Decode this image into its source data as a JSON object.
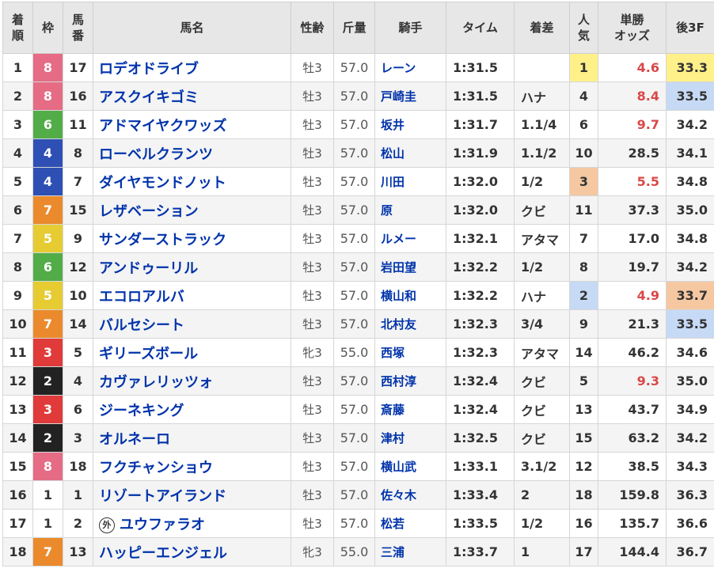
{
  "headers": {
    "rank": [
      "着",
      "順"
    ],
    "waku": "枠",
    "number": [
      "馬",
      "番"
    ],
    "name": "馬名",
    "sex_age": "性齢",
    "weight": "斤量",
    "jockey": "騎手",
    "time": "タイム",
    "margin": "着差",
    "popularity": [
      "人",
      "気"
    ],
    "odds": [
      "単勝",
      "オッズ"
    ],
    "last3f": "後3F"
  },
  "colors": {
    "waku": {
      "1": {
        "bg": "#ffffff",
        "fg": "#333333"
      },
      "2": {
        "bg": "#222222",
        "fg": "#ffffff"
      },
      "3": {
        "bg": "#e03a3a",
        "fg": "#ffffff"
      },
      "4": {
        "bg": "#2e50b4",
        "fg": "#ffffff"
      },
      "5": {
        "bg": "#e6cc32",
        "fg": "#ffffff"
      },
      "6": {
        "bg": "#52ac48",
        "fg": "#ffffff"
      },
      "7": {
        "bg": "#ea8a2c",
        "fg": "#ffffff"
      },
      "8": {
        "bg": "#e56c84",
        "fg": "#ffffff"
      }
    },
    "pop_highlight": {
      "1": "#fff08a",
      "2": "#c7daf5",
      "3": "#f5c8a2"
    },
    "last3f_highlight": {
      "1": "#fff08a",
      "2": "#c7daf5",
      "3": "#f5c8a2"
    },
    "odds_red": "#d94848"
  },
  "rows": [
    {
      "rank": "1",
      "waku": "8",
      "number": "17",
      "mark": "",
      "name": "ロデオドライブ",
      "sex_age": "牡3",
      "weight": "57.0",
      "jockey": "レーン",
      "time": "1:31.5",
      "margin": "",
      "popularity": "1",
      "odds": "4.6",
      "last3f": "33.3",
      "pop_rank": "1",
      "last3f_rank": "1",
      "odds_red": true
    },
    {
      "rank": "2",
      "waku": "8",
      "number": "16",
      "mark": "",
      "name": "アスクイキゴミ",
      "sex_age": "牡3",
      "weight": "57.0",
      "jockey": "戸崎圭",
      "time": "1:31.5",
      "margin": "ハナ",
      "popularity": "4",
      "odds": "8.4",
      "last3f": "33.5",
      "pop_rank": "",
      "last3f_rank": "2",
      "odds_red": true
    },
    {
      "rank": "3",
      "waku": "6",
      "number": "11",
      "mark": "",
      "name": "アドマイヤクワッズ",
      "sex_age": "牡3",
      "weight": "57.0",
      "jockey": "坂井",
      "time": "1:31.7",
      "margin": "1.1/4",
      "popularity": "6",
      "odds": "9.7",
      "last3f": "34.2",
      "pop_rank": "",
      "last3f_rank": "",
      "odds_red": true
    },
    {
      "rank": "4",
      "waku": "4",
      "number": "8",
      "mark": "",
      "name": "ローベルクランツ",
      "sex_age": "牡3",
      "weight": "57.0",
      "jockey": "松山",
      "time": "1:31.9",
      "margin": "1.1/2",
      "popularity": "10",
      "odds": "28.5",
      "last3f": "34.1",
      "pop_rank": "",
      "last3f_rank": "",
      "odds_red": false
    },
    {
      "rank": "5",
      "waku": "4",
      "number": "7",
      "mark": "",
      "name": "ダイヤモンドノット",
      "sex_age": "牡3",
      "weight": "57.0",
      "jockey": "川田",
      "time": "1:32.0",
      "margin": "1/2",
      "popularity": "3",
      "odds": "5.5",
      "last3f": "34.8",
      "pop_rank": "3",
      "last3f_rank": "",
      "odds_red": true
    },
    {
      "rank": "6",
      "waku": "7",
      "number": "15",
      "mark": "",
      "name": "レザベーション",
      "sex_age": "牡3",
      "weight": "57.0",
      "jockey": "原",
      "time": "1:32.0",
      "margin": "クビ",
      "popularity": "11",
      "odds": "37.3",
      "last3f": "35.0",
      "pop_rank": "",
      "last3f_rank": "",
      "odds_red": false
    },
    {
      "rank": "7",
      "waku": "5",
      "number": "9",
      "mark": "",
      "name": "サンダーストラック",
      "sex_age": "牡3",
      "weight": "57.0",
      "jockey": "ルメー",
      "time": "1:32.1",
      "margin": "アタマ",
      "popularity": "7",
      "odds": "17.0",
      "last3f": "34.8",
      "pop_rank": "",
      "last3f_rank": "",
      "odds_red": false
    },
    {
      "rank": "8",
      "waku": "6",
      "number": "12",
      "mark": "",
      "name": "アンドゥーリル",
      "sex_age": "牡3",
      "weight": "57.0",
      "jockey": "岩田望",
      "time": "1:32.2",
      "margin": "1/2",
      "popularity": "8",
      "odds": "19.7",
      "last3f": "34.2",
      "pop_rank": "",
      "last3f_rank": "",
      "odds_red": false
    },
    {
      "rank": "9",
      "waku": "5",
      "number": "10",
      "mark": "",
      "name": "エコロアルバ",
      "sex_age": "牡3",
      "weight": "57.0",
      "jockey": "横山和",
      "time": "1:32.2",
      "margin": "ハナ",
      "popularity": "2",
      "odds": "4.9",
      "last3f": "33.7",
      "pop_rank": "2",
      "last3f_rank": "3",
      "odds_red": true
    },
    {
      "rank": "10",
      "waku": "7",
      "number": "14",
      "mark": "",
      "name": "バルセシート",
      "sex_age": "牡3",
      "weight": "57.0",
      "jockey": "北村友",
      "time": "1:32.3",
      "margin": "3/4",
      "popularity": "9",
      "odds": "21.3",
      "last3f": "33.5",
      "pop_rank": "",
      "last3f_rank": "2",
      "odds_red": false
    },
    {
      "rank": "11",
      "waku": "3",
      "number": "5",
      "mark": "",
      "name": "ギリーズボール",
      "sex_age": "牝3",
      "weight": "55.0",
      "jockey": "西塚",
      "time": "1:32.3",
      "margin": "アタマ",
      "popularity": "14",
      "odds": "46.2",
      "last3f": "34.6",
      "pop_rank": "",
      "last3f_rank": "",
      "odds_red": false
    },
    {
      "rank": "12",
      "waku": "2",
      "number": "4",
      "mark": "",
      "name": "カヴァレリッツォ",
      "sex_age": "牡3",
      "weight": "57.0",
      "jockey": "西村淳",
      "time": "1:32.4",
      "margin": "クビ",
      "popularity": "5",
      "odds": "9.3",
      "last3f": "35.0",
      "pop_rank": "",
      "last3f_rank": "",
      "odds_red": true
    },
    {
      "rank": "13",
      "waku": "3",
      "number": "6",
      "mark": "",
      "name": "ジーネキング",
      "sex_age": "牡3",
      "weight": "57.0",
      "jockey": "斎藤",
      "time": "1:32.4",
      "margin": "クビ",
      "popularity": "13",
      "odds": "43.7",
      "last3f": "34.9",
      "pop_rank": "",
      "last3f_rank": "",
      "odds_red": false
    },
    {
      "rank": "14",
      "waku": "2",
      "number": "3",
      "mark": "",
      "name": "オルネーロ",
      "sex_age": "牡3",
      "weight": "57.0",
      "jockey": "津村",
      "time": "1:32.5",
      "margin": "クビ",
      "popularity": "15",
      "odds": "63.2",
      "last3f": "34.2",
      "pop_rank": "",
      "last3f_rank": "",
      "odds_red": false
    },
    {
      "rank": "15",
      "waku": "8",
      "number": "18",
      "mark": "",
      "name": "フクチャンショウ",
      "sex_age": "牡3",
      "weight": "57.0",
      "jockey": "横山武",
      "time": "1:33.1",
      "margin": "3.1/2",
      "popularity": "12",
      "odds": "38.5",
      "last3f": "34.3",
      "pop_rank": "",
      "last3f_rank": "",
      "odds_red": false
    },
    {
      "rank": "16",
      "waku": "1",
      "number": "1",
      "mark": "",
      "name": "リゾートアイランド",
      "sex_age": "牡3",
      "weight": "57.0",
      "jockey": "佐々木",
      "time": "1:33.4",
      "margin": "2",
      "popularity": "18",
      "odds": "159.8",
      "last3f": "36.3",
      "pop_rank": "",
      "last3f_rank": "",
      "odds_red": false
    },
    {
      "rank": "17",
      "waku": "1",
      "number": "2",
      "mark": "外",
      "name": "ユウファラオ",
      "sex_age": "牡3",
      "weight": "57.0",
      "jockey": "松若",
      "time": "1:33.5",
      "margin": "1/2",
      "popularity": "16",
      "odds": "135.7",
      "last3f": "36.6",
      "pop_rank": "",
      "last3f_rank": "",
      "odds_red": false
    },
    {
      "rank": "18",
      "waku": "7",
      "number": "13",
      "mark": "",
      "name": "ハッピーエンジェル",
      "sex_age": "牝3",
      "weight": "55.0",
      "jockey": "三浦",
      "time": "1:33.7",
      "margin": "1",
      "popularity": "17",
      "odds": "144.4",
      "last3f": "36.7",
      "pop_rank": "",
      "last3f_rank": "",
      "odds_red": false
    }
  ]
}
